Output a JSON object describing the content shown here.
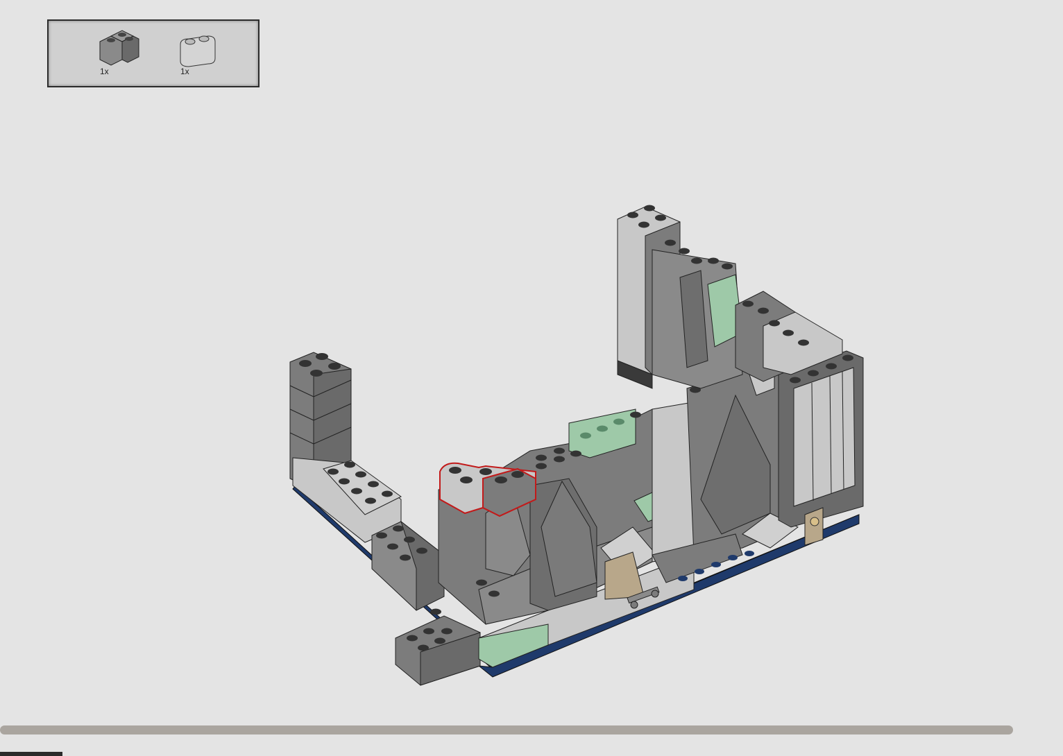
{
  "parts_list": {
    "items": [
      {
        "icon": "corner-brick-2x2-dark-gray-icon",
        "color": "#7a7a7a",
        "quantity": "1x"
      },
      {
        "icon": "round-brick-1x2-light-gray-icon",
        "color": "#c9c9c9",
        "quantity": "1x"
      }
    ]
  },
  "colors": {
    "background": "#e4e4e4",
    "dark_gray": "#7c7c7c",
    "light_gray": "#c8c8c8",
    "sand_green": "#9ec9a8",
    "dark_blue": "#1f3a6b",
    "tan": "#b8a78a",
    "highlight": "#c21a1a",
    "progress": "#aaa59f"
  },
  "progress": {
    "fraction": 0.95
  }
}
